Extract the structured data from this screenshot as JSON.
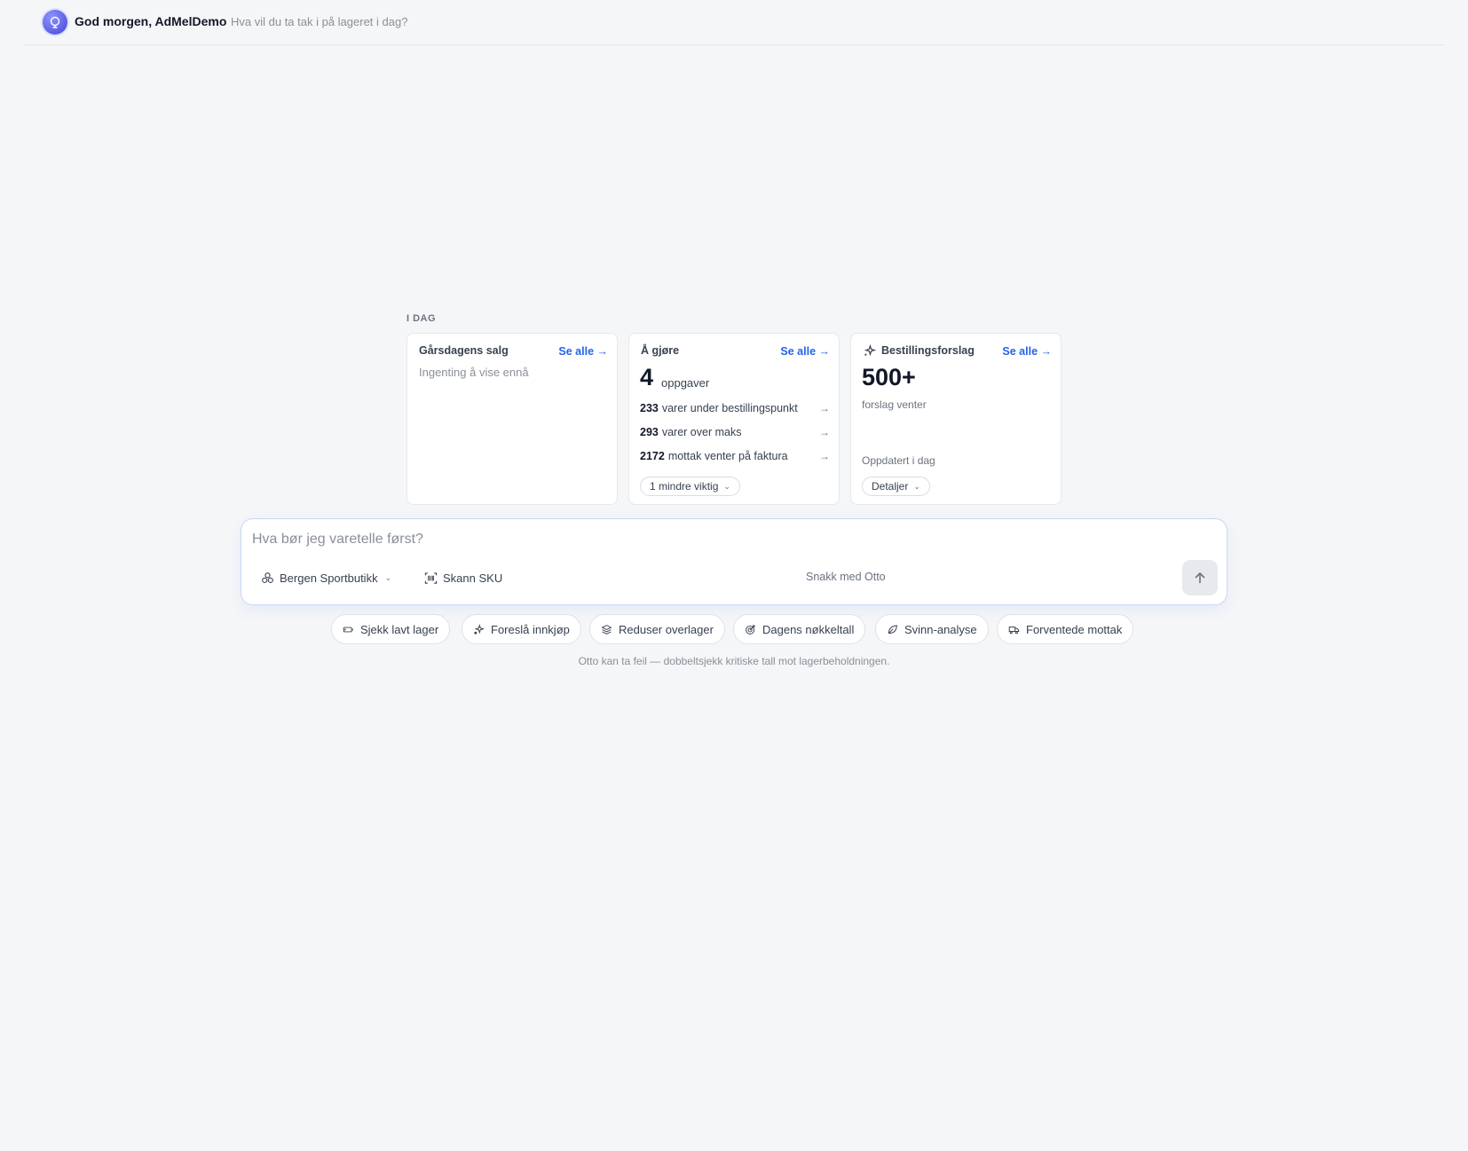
{
  "header": {
    "greeting": "God morgen, AdMelDemo",
    "subtitle": "Hva vil du ta tak i på lageret i dag?",
    "avatar_icon": "robot-icon"
  },
  "today": {
    "label": "I DAG",
    "sales": {
      "title": "Gårsdagens salg",
      "see_all": "Se alle →",
      "empty": "Ingenting å vise ennå"
    },
    "todo": {
      "title": "Å gjøre",
      "see_all": "Se alle →",
      "count": "4",
      "unit": "oppgaver",
      "tasks": [
        {
          "num": "233",
          "text": "varer under bestillingspunkt",
          "arrow": "→"
        },
        {
          "num": "293",
          "text": "varer over maks",
          "arrow": "→"
        },
        {
          "num": "2172",
          "text": "mottak venter på faktura",
          "arrow": "→"
        }
      ],
      "less_important": "1 mindre viktig"
    },
    "suggestions": {
      "title": "Bestillingsforslag",
      "see_all": "Se alle →",
      "count": "500+",
      "sub": "forslag venter",
      "updated": "Oppdatert i dag",
      "details": "Detaljer"
    }
  },
  "composer": {
    "placeholder": "Hva bør jeg varetelle først?",
    "store": "Bergen Sportbutikk",
    "scan": "Skann SKU",
    "talk": "Snakk med Otto"
  },
  "chips": [
    {
      "label": "Sjekk lavt lager",
      "icon": "battery-low-icon"
    },
    {
      "label": "Foreslå innkjøp",
      "icon": "sparkle-icon"
    },
    {
      "label": "Reduser overlager",
      "icon": "layers-icon"
    },
    {
      "label": "Dagens nøkkeltall",
      "icon": "target-icon"
    },
    {
      "label": "Svinn-analyse",
      "icon": "leaf-icon"
    },
    {
      "label": "Forventede mottak",
      "icon": "truck-icon"
    }
  ],
  "disclaimer": "Otto kan ta feil — dobbeltsjekk kritiske tall mot lagerbeholdningen.",
  "colors": {
    "accent": "#2563eb",
    "avatar": "#5b5ce2",
    "background": "#f5f6f8"
  }
}
